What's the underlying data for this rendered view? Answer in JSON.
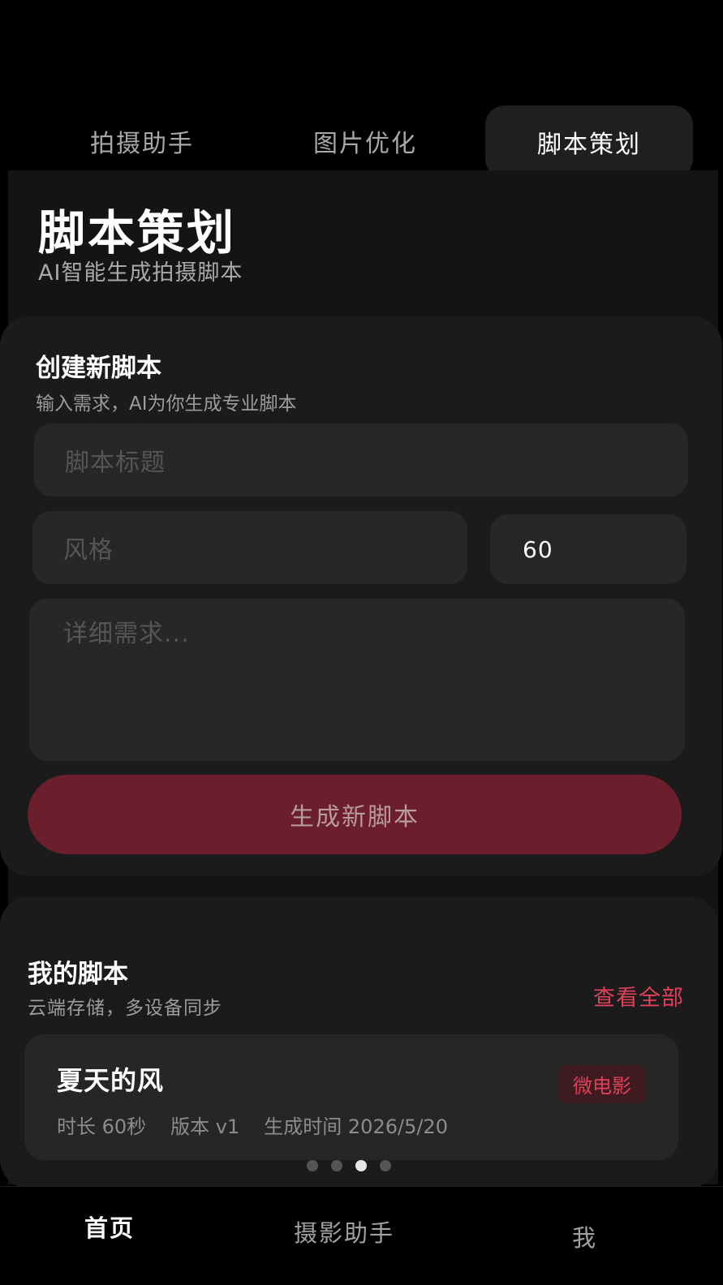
{
  "top_tabs": [
    {
      "label": "拍摄助手",
      "active": false
    },
    {
      "label": "图片优化",
      "active": false
    },
    {
      "label": "脚本策划",
      "active": true
    }
  ],
  "page": {
    "title": "脚本策划",
    "subtitle": "AI智能生成拍摄脚本"
  },
  "create_card": {
    "title": "创建新脚本",
    "subtitle": "输入需求，AI为你生成专业脚本",
    "title_placeholder": "脚本标题",
    "style_placeholder": "风格",
    "duration_value": "60",
    "detail_placeholder": "详细需求...",
    "generate_label": "生成新脚本"
  },
  "scripts_card": {
    "title": "我的脚本",
    "subtitle": "云端存储，多设备同步",
    "view_all": "查看全部",
    "items": [
      {
        "name": "夏天的风",
        "tag": "微电影",
        "duration": "时长 60秒",
        "version": "版本 v1",
        "created": "生成时间 2026/5/20"
      }
    ]
  },
  "pager": {
    "count": 4,
    "active_index": 2
  },
  "bottom_nav": [
    {
      "label": "首页",
      "active": true
    },
    {
      "label": "摄影助手",
      "active": false
    },
    {
      "label": "我",
      "active": false
    }
  ],
  "colors": {
    "accent": "#e0405a",
    "button_bg": "#6b1e2c",
    "card_bg": "#1b1b1b",
    "field_bg": "#272727"
  }
}
